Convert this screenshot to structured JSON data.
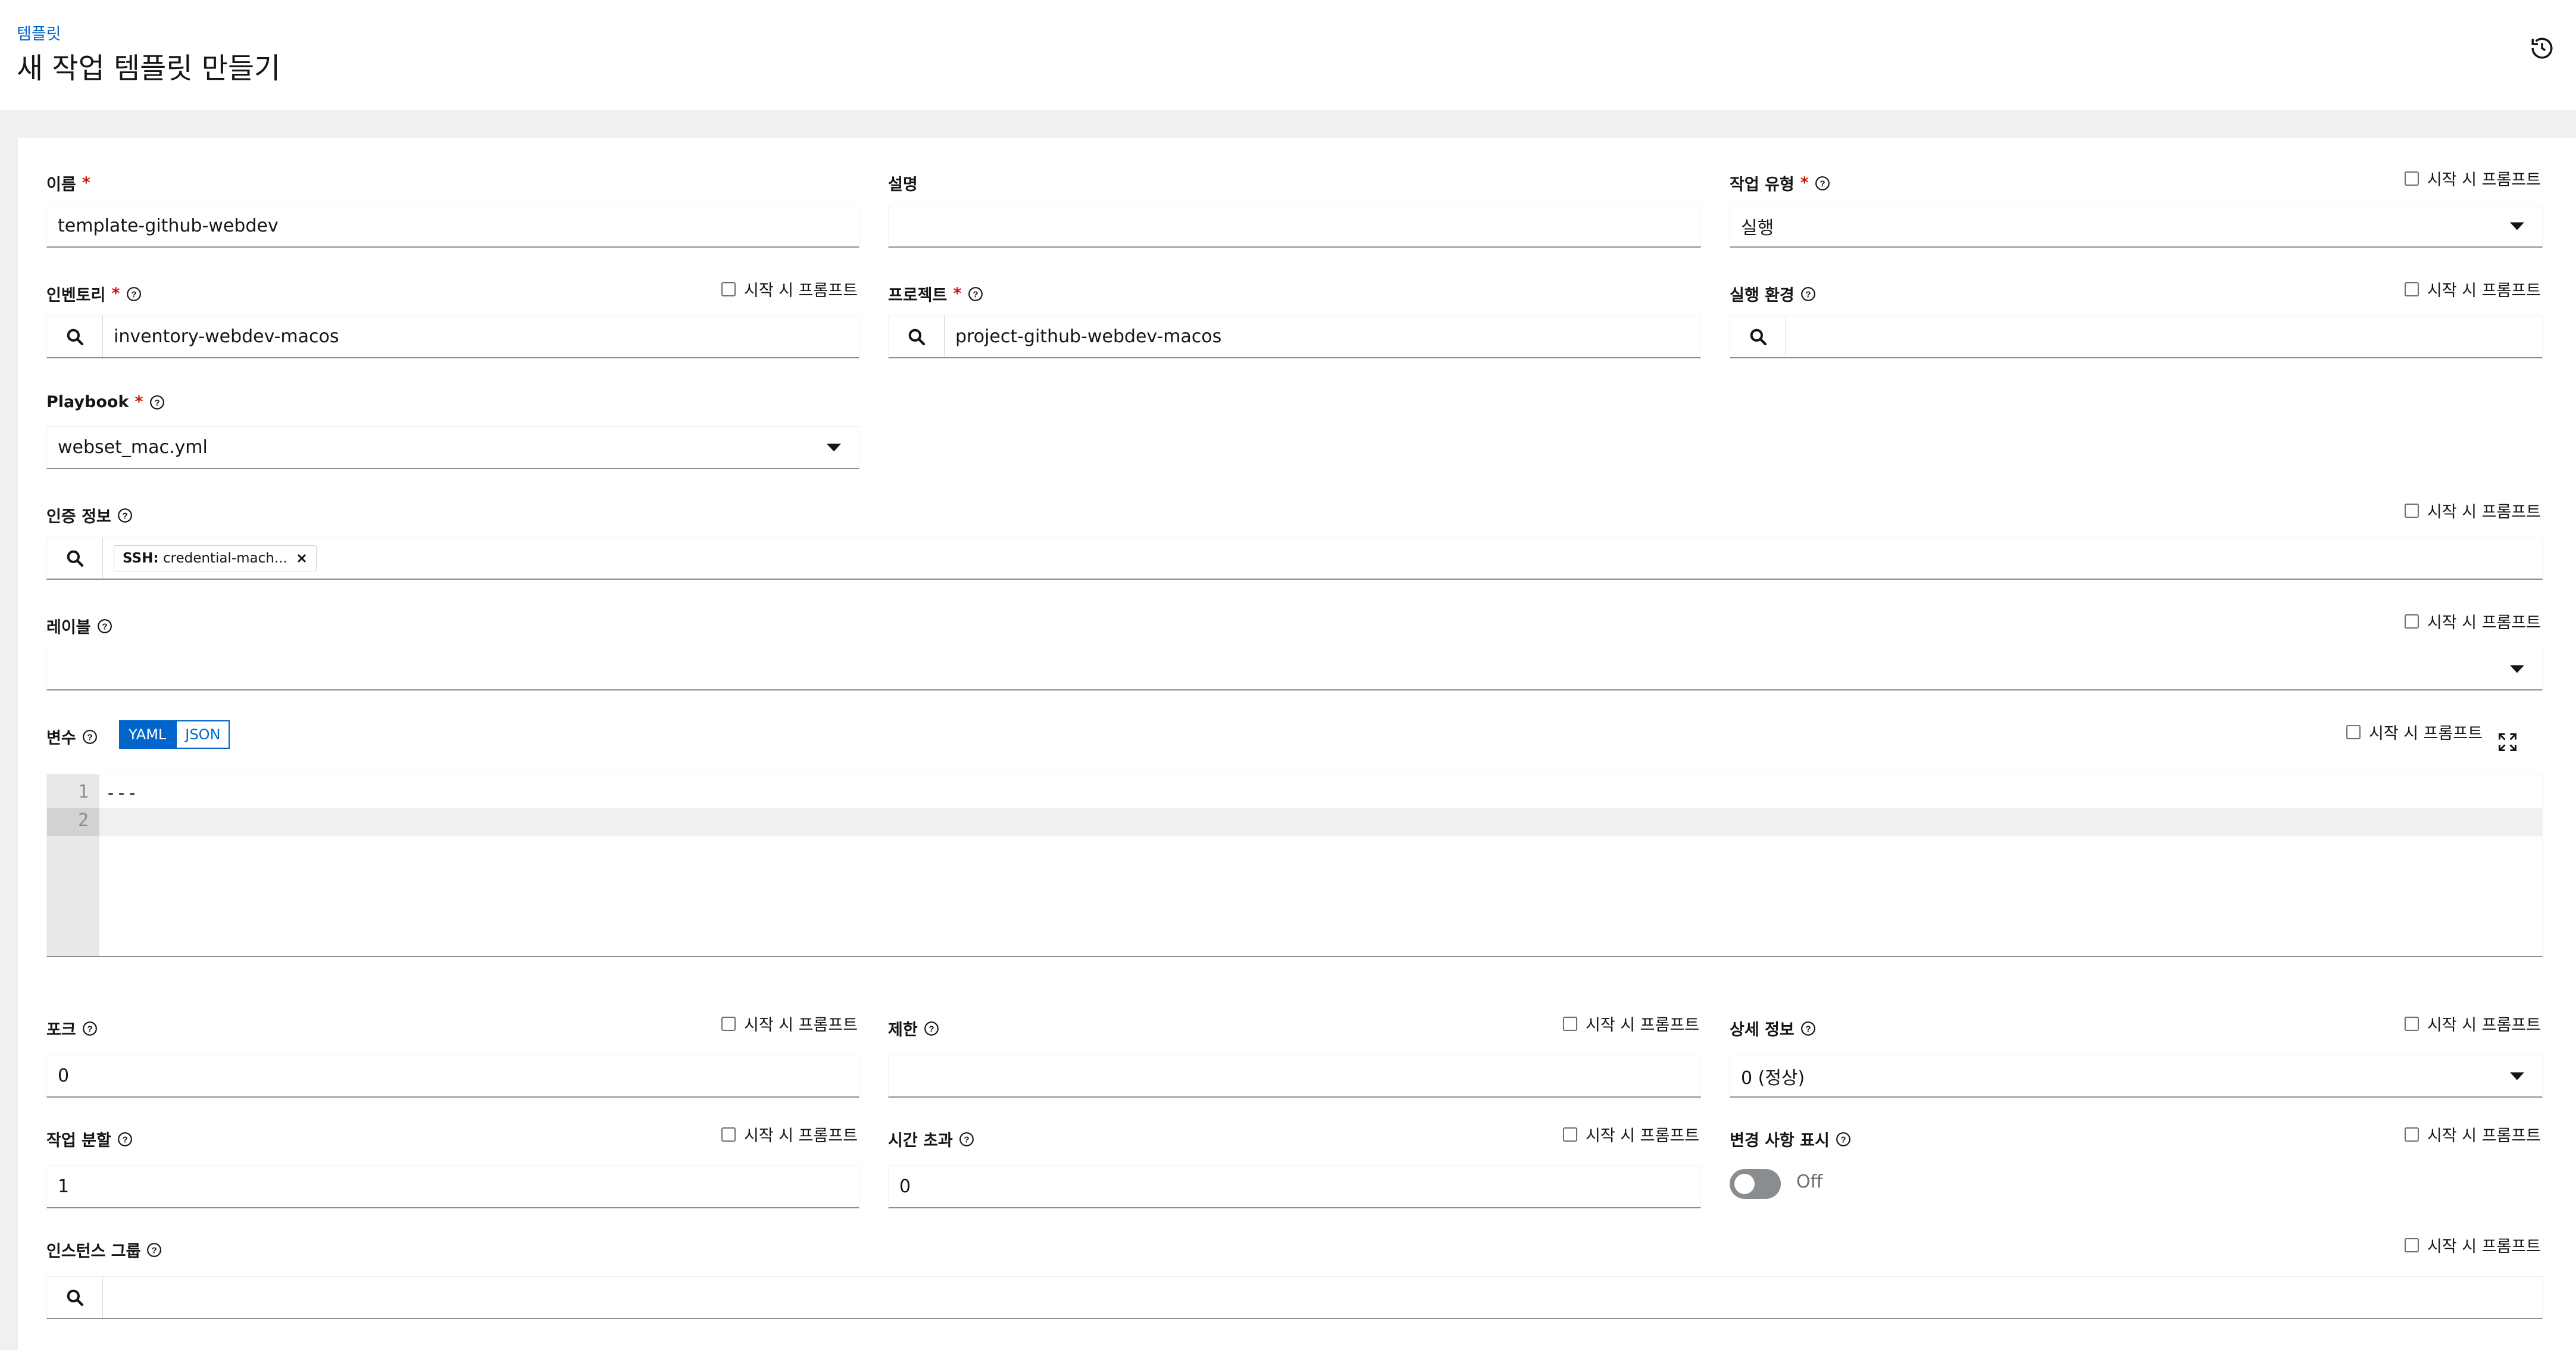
{
  "header": {
    "breadcrumb": "템플릿",
    "title": "새 작업 템플릿 만들기"
  },
  "prompt_label": "시작 시 프롬프트",
  "fields": {
    "name": {
      "label": "이름",
      "value": "template-github-webdev"
    },
    "description": {
      "label": "설명",
      "value": ""
    },
    "job_type": {
      "label": "작업 유형",
      "value": "실행"
    },
    "inventory": {
      "label": "인벤토리",
      "value": "inventory-webdev-macos"
    },
    "project": {
      "label": "프로젝트",
      "value": "project-github-webdev-macos"
    },
    "execution_env": {
      "label": "실행 환경",
      "value": ""
    },
    "playbook": {
      "label": "Playbook",
      "value": "webset_mac.yml"
    },
    "credentials": {
      "label": "인증 정보",
      "chip_type": "SSH:",
      "chip_value": "credential-mach..."
    },
    "labels": {
      "label": "레이블"
    },
    "variables": {
      "label": "변수",
      "yaml": "YAML",
      "json": "JSON",
      "lines": [
        "1",
        "2"
      ],
      "code": "---"
    },
    "forks": {
      "label": "포크",
      "value": "0"
    },
    "limit": {
      "label": "제한",
      "value": ""
    },
    "verbosity": {
      "label": "상세 정보",
      "value": "0 (정상)"
    },
    "job_slicing": {
      "label": "작업 분할",
      "value": "1"
    },
    "timeout": {
      "label": "시간 초과",
      "value": "0"
    },
    "show_changes": {
      "label": "변경 사항 표시",
      "state": "Off"
    },
    "instance_groups": {
      "label": "인스턴스 그룹"
    }
  },
  "icons": {
    "history": "history-icon",
    "search": "search-icon",
    "help": "help-icon",
    "expand": "expand-icon",
    "close": "close-icon"
  },
  "colors": {
    "link": "#0066cc",
    "required": "#c9190b",
    "toggle_active": "#0066cc",
    "switch_off": "#8a8d90"
  }
}
